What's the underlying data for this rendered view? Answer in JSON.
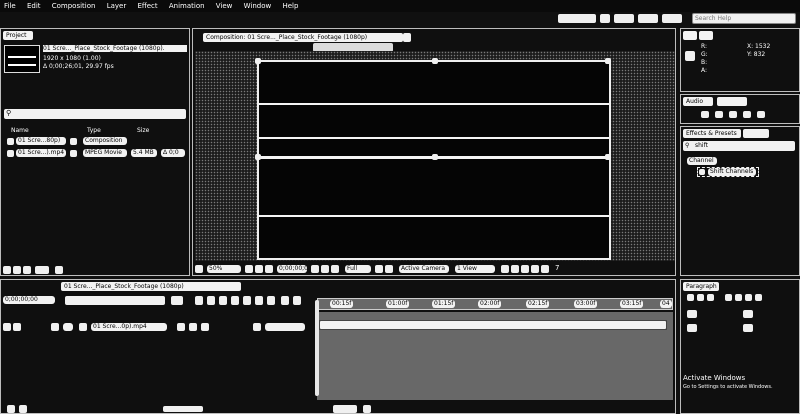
{
  "menu": [
    "File",
    "Edit",
    "Composition",
    "Layer",
    "Effect",
    "Animation",
    "View",
    "Window",
    "Help"
  ],
  "search_help": {
    "placeholder": "Search Help"
  },
  "project": {
    "tab_label": "Project",
    "item_name": "01 Scre..._Place_Stock_Footage (1080p).",
    "item_resolution": "1920 x 1080 (1.00)",
    "item_duration": "Δ 0;00;26;01, 29.97 fps",
    "col_name": "Name",
    "col_type": "Type",
    "col_size": "Size",
    "rows": [
      {
        "name": "01 Scre...80p)",
        "type": "Composition",
        "size": ""
      },
      {
        "name": "01 Scre...).mp4",
        "type": "MPEG Movie",
        "size": "5.4 MB",
        "extra": "Δ 0;0"
      }
    ]
  },
  "composition": {
    "tab_label": "Composition: 01 Scre..._Place_Stock_Footage (1080p)",
    "zoom_label": "50%",
    "time_label": "0;00;00;00",
    "quality_label": "Full",
    "camera_label": "Active Camera",
    "view_label": "1 View",
    "extra": "7"
  },
  "info": {
    "line1": "R:",
    "line2": "G:",
    "line3": "B:",
    "line4": "A:",
    "x": "X: 1532",
    "y": "Y: 832"
  },
  "audio": {
    "tab_label": "Audio"
  },
  "effects": {
    "tab_label": "Effects & Presets",
    "search_value": "shift",
    "category": "Channel",
    "item": "Shift Channels"
  },
  "timeline": {
    "tab_label": "01 Scre..._Place_Stock_Footage (1080p)",
    "timecode": "0;00;00;00",
    "layer_name": "01 Scre...0p).mp4",
    "ruler": [
      "00:15f",
      "01:00f",
      "01:15f",
      "02:00f",
      "02:15f",
      "03:00f",
      "03:15f",
      "04"
    ]
  },
  "paragraph": {
    "tab_label": "Paragraph"
  },
  "watermark": {
    "line1": "Activate Windows",
    "line2": "Go to Settings to activate Windows."
  }
}
